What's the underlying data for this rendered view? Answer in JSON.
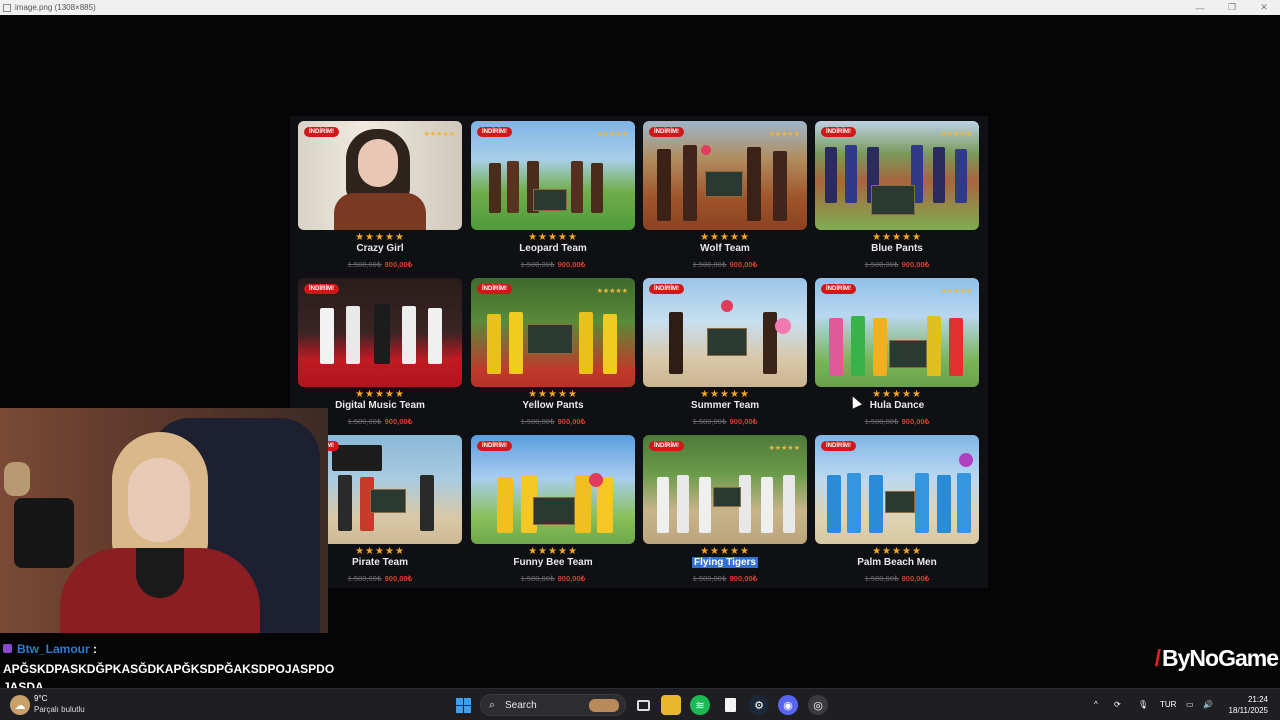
{
  "viewer": {
    "title": "image.png (1308×885)"
  },
  "cards": [
    {
      "badge": "İNDİRİM!",
      "stars": "★★★★★",
      "title": "Crazy Girl",
      "old_price": "1.500,00₺",
      "new_price": "800,00₺"
    },
    {
      "badge": "İNDİRİM!",
      "stars": "★★★★★",
      "title": "Leopard Team",
      "old_price": "1.500,00₺",
      "new_price": "900,00₺"
    },
    {
      "badge": "İNDİRİM!",
      "stars": "★★★★★",
      "title": "Wolf Team",
      "old_price": "1.500,00₺",
      "new_price": "900,00₺"
    },
    {
      "badge": "İNDİRİM!",
      "stars": "★★★★★",
      "title": "Blue Pants",
      "old_price": "1.500,00₺",
      "new_price": "900,00₺"
    },
    {
      "badge": "İNDİRİM!",
      "stars": "★★★★★",
      "title": "Digital Music Team",
      "old_price": "1.500,00₺",
      "new_price": "900,00₺"
    },
    {
      "badge": "İNDİRİM!",
      "stars": "★★★★★",
      "title": "Yellow Pants",
      "old_price": "1.500,00₺",
      "new_price": "900,00₺"
    },
    {
      "badge": "İNDİRİM!",
      "stars": "★★★★★",
      "title": "Summer Team",
      "old_price": "1.500,00₺",
      "new_price": "900,00₺"
    },
    {
      "badge": "İNDİRİM!",
      "stars": "★★★★★",
      "title": "Hula Dance",
      "old_price": "1.500,00₺",
      "new_price": "900,00₺"
    },
    {
      "badge": "İNDİRİM!",
      "stars": "★★★★★",
      "title": "Pirate Team",
      "old_price": "1.500,00₺",
      "new_price": "900,00₺"
    },
    {
      "badge": "İNDİRİM!",
      "stars": "★★★★★",
      "title": "Funny Bee Team",
      "old_price": "1.500,00₺",
      "new_price": "900,00₺"
    },
    {
      "badge": "İNDİRİM!",
      "stars": "★★★★★",
      "title": "Flying Tigers",
      "old_price": "1.500,00₺",
      "new_price": "900,00₺",
      "selected": true
    },
    {
      "badge": "İNDİRİM!",
      "stars": "★★★★★",
      "title": "Palm Beach Men",
      "old_price": "1.500,00₺",
      "new_price": "900,00₺"
    }
  ],
  "chat": {
    "username": "Btw_Lamour",
    "separator": ":",
    "message": "APĞSKDPASKDĞPKASĞDKAPĞKSDPĞAKSDPOJASPDO JASDA"
  },
  "brand": {
    "slash": "/",
    "name": "ByNoGame"
  },
  "taskbar": {
    "weather_temp": "9°C",
    "weather_desc": "Parçalı bulutlu",
    "search_placeholder": "Search",
    "language": "TUR",
    "time": "21:24",
    "date": "18/11/2025"
  },
  "colors": {
    "badge": "#d01818",
    "stars": "#f5a623",
    "new_price": "#e23b2e",
    "chat_username": "#2c7bd6",
    "selection": "#2f6fd6"
  }
}
